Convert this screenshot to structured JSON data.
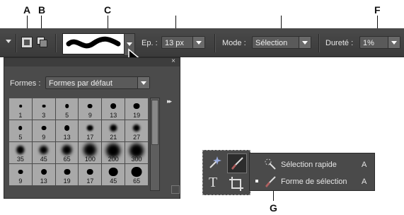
{
  "callouts": {
    "a": "A",
    "b": "B",
    "c": "C",
    "f": "F",
    "g": "G"
  },
  "options_bar": {
    "size_label": "Ep. :",
    "size_value": "13 px",
    "mode_label": "Mode :",
    "mode_value": "Sélection",
    "hardness_label": "Dureté :",
    "hardness_value": "1%"
  },
  "brush_panel": {
    "shapes_label": "Formes :",
    "shapes_value": "Formes par défaut",
    "close_glyph": "×",
    "menu_glyph": "▸▸",
    "brushes": [
      [
        "1",
        "3",
        "5",
        "9",
        "13",
        "19"
      ],
      [
        "5",
        "9",
        "13",
        "17",
        "21",
        "27"
      ],
      [
        "35",
        "45",
        "65",
        "100",
        "200",
        "300"
      ],
      [
        "9",
        "13",
        "19",
        "17",
        "45",
        "65"
      ]
    ]
  },
  "flyout": {
    "items": [
      {
        "label": "Sélection rapide",
        "shortcut": "A"
      },
      {
        "label": "Forme de sélection",
        "shortcut": "A"
      }
    ]
  },
  "icons": {
    "tool_menu": "caret-down-icon",
    "new_selection": "new-selection-icon",
    "add_selection": "add-to-selection-icon",
    "cursor": "arrow-cursor-icon"
  }
}
